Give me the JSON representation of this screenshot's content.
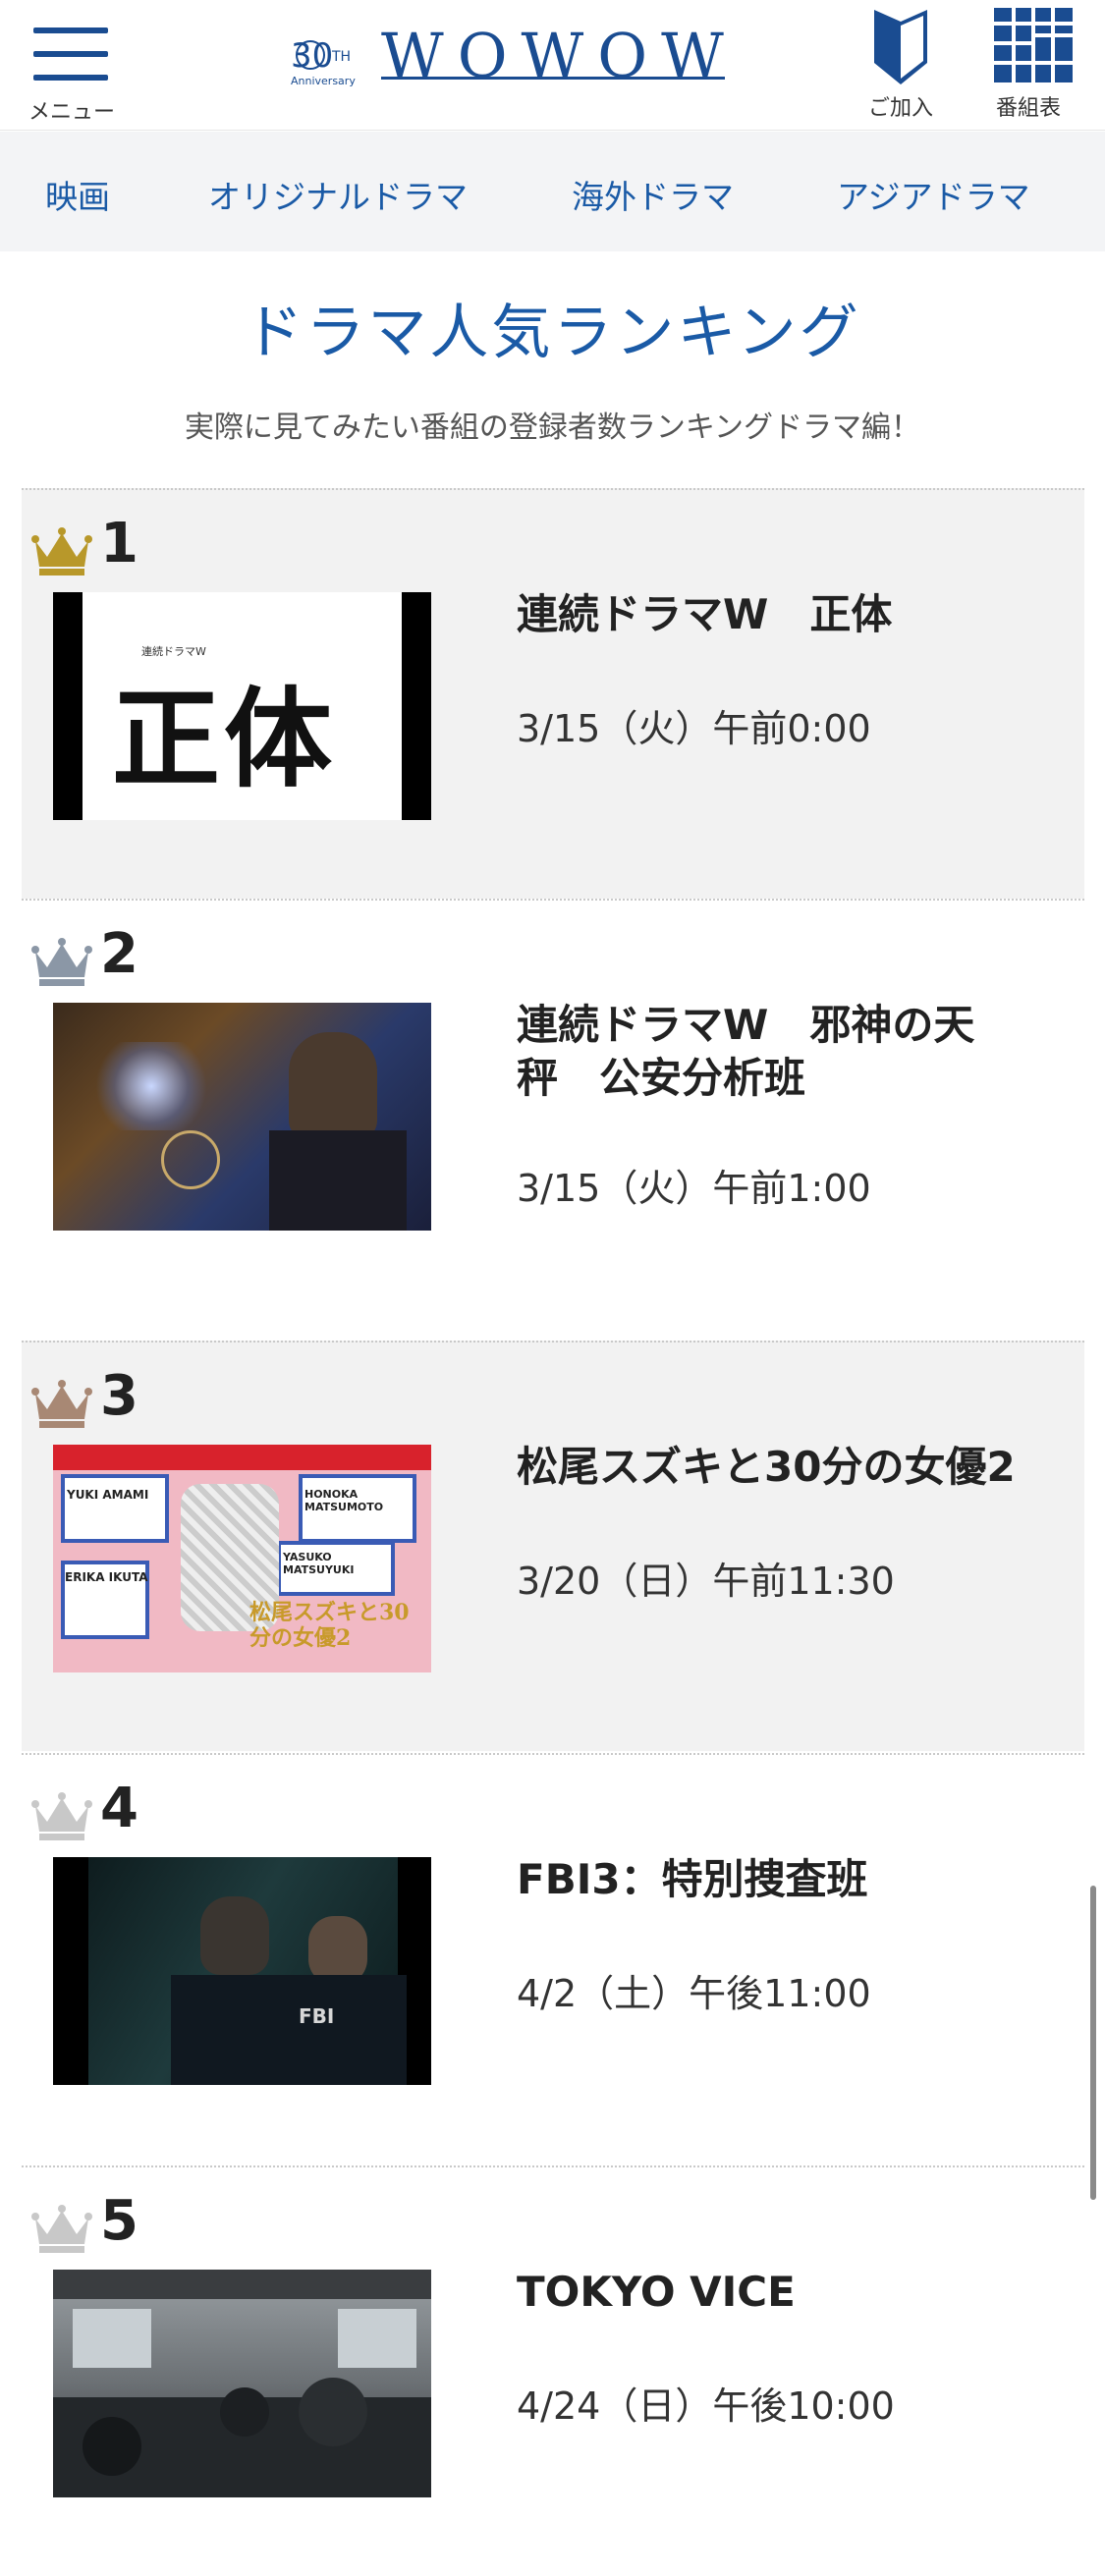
{
  "header": {
    "menu_label": "メニュー",
    "logo_anniversary_number": "30",
    "logo_anniversary_suffix": "TH",
    "logo_anniversary_text": "Anniversary",
    "logo_text": "WOWOW",
    "join_label": "ご加入",
    "schedule_label": "番組表",
    "brand_color": "#1a4c91"
  },
  "categories": [
    "映画",
    "オリジナルドラマ",
    "海外ドラマ",
    "アジアドラマ"
  ],
  "section": {
    "title": "ドラマ人気ランキング",
    "subtitle": "実際に見てみたい番組の登録者数ランキングドラマ編！"
  },
  "rankings": [
    {
      "rank": "1",
      "crown_color": "#b8982a",
      "title_line1": "連続ドラマW　正体",
      "title_line2": "",
      "airtime": "3/15（火）午前0:00",
      "thumb_text": "正体",
      "thumb_small_text": "連続ドラマW"
    },
    {
      "rank": "2",
      "crown_color": "#8b97a6",
      "title_line1": "連続ドラマW　邪神の天",
      "title_line2": "秤　公安分析班",
      "airtime": "3/15（火）午前1:00"
    },
    {
      "rank": "3",
      "crown_color": "#a88874",
      "title_line1": "松尾スズキと30分の女優2",
      "title_line2": "",
      "airtime": "3/20（日）午前11:30",
      "thumb_labels": [
        "YUKI AMAMI",
        "HONOKA MATSUMOTO",
        "ERIKA IKUTA",
        "YASUKO MATSUYUKI"
      ],
      "thumb_title": "松尾スズキと30分の女優2"
    },
    {
      "rank": "4",
      "crown_color": "#c8c8c8",
      "title_line1": "FBI3：特別捜査班",
      "title_line2": "",
      "airtime": "4/2（土）午後11:00",
      "thumb_text": "FBI"
    },
    {
      "rank": "5",
      "crown_color": "#c8c8c8",
      "title_line1": "TOKYO VICE",
      "title_line2": "",
      "airtime": "4/24（日）午後10:00"
    }
  ]
}
